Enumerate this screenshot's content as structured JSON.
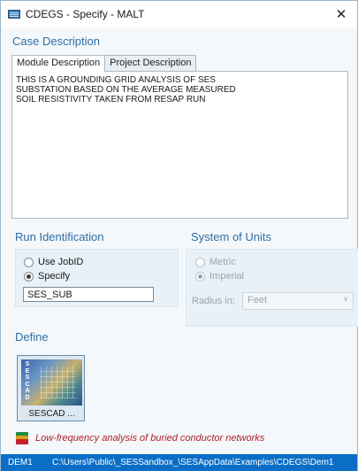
{
  "window": {
    "title": "CDEGS - Specify - MALT",
    "app_icon": "app-window-icon",
    "close_glyph": "✕"
  },
  "case_description": {
    "heading": "Case Description",
    "tabs": [
      {
        "label": "Module Description",
        "active": true
      },
      {
        "label": "Project Description",
        "active": false
      }
    ],
    "text": "THIS IS A GROUNDING GRID ANALYSIS OF SES\nSUBSTATION BASED ON THE AVERAGE MEASURED\nSOIL RESISTIVITY TAKEN FROM RESAP RUN"
  },
  "run_identification": {
    "heading": "Run Identification",
    "options": [
      {
        "label": "Use JobID",
        "checked": false
      },
      {
        "label": "Specify",
        "checked": true
      }
    ],
    "value": "SES_SUB"
  },
  "system_of_units": {
    "heading": "System of Units",
    "options": [
      {
        "label": "Metric",
        "checked": false,
        "disabled": true
      },
      {
        "label": "Imperial",
        "checked": true,
        "disabled": true
      }
    ],
    "radius_label": "Radius in:",
    "radius_value": "Feet"
  },
  "define": {
    "heading": "Define",
    "tile_label": "SESCAD ...",
    "tile_letters": "SESCAD"
  },
  "module_description": "Low-frequency analysis of buried conductor networks",
  "status": {
    "code": "DEM1",
    "path": "C:\\Users\\Public\\_SESSandbox_\\SESAppData\\Examples\\CDEGS\\Dem1"
  },
  "colors": {
    "accent": "#2e6da4",
    "status_bar": "#0a6ec7",
    "description_text": "#b0202a"
  }
}
